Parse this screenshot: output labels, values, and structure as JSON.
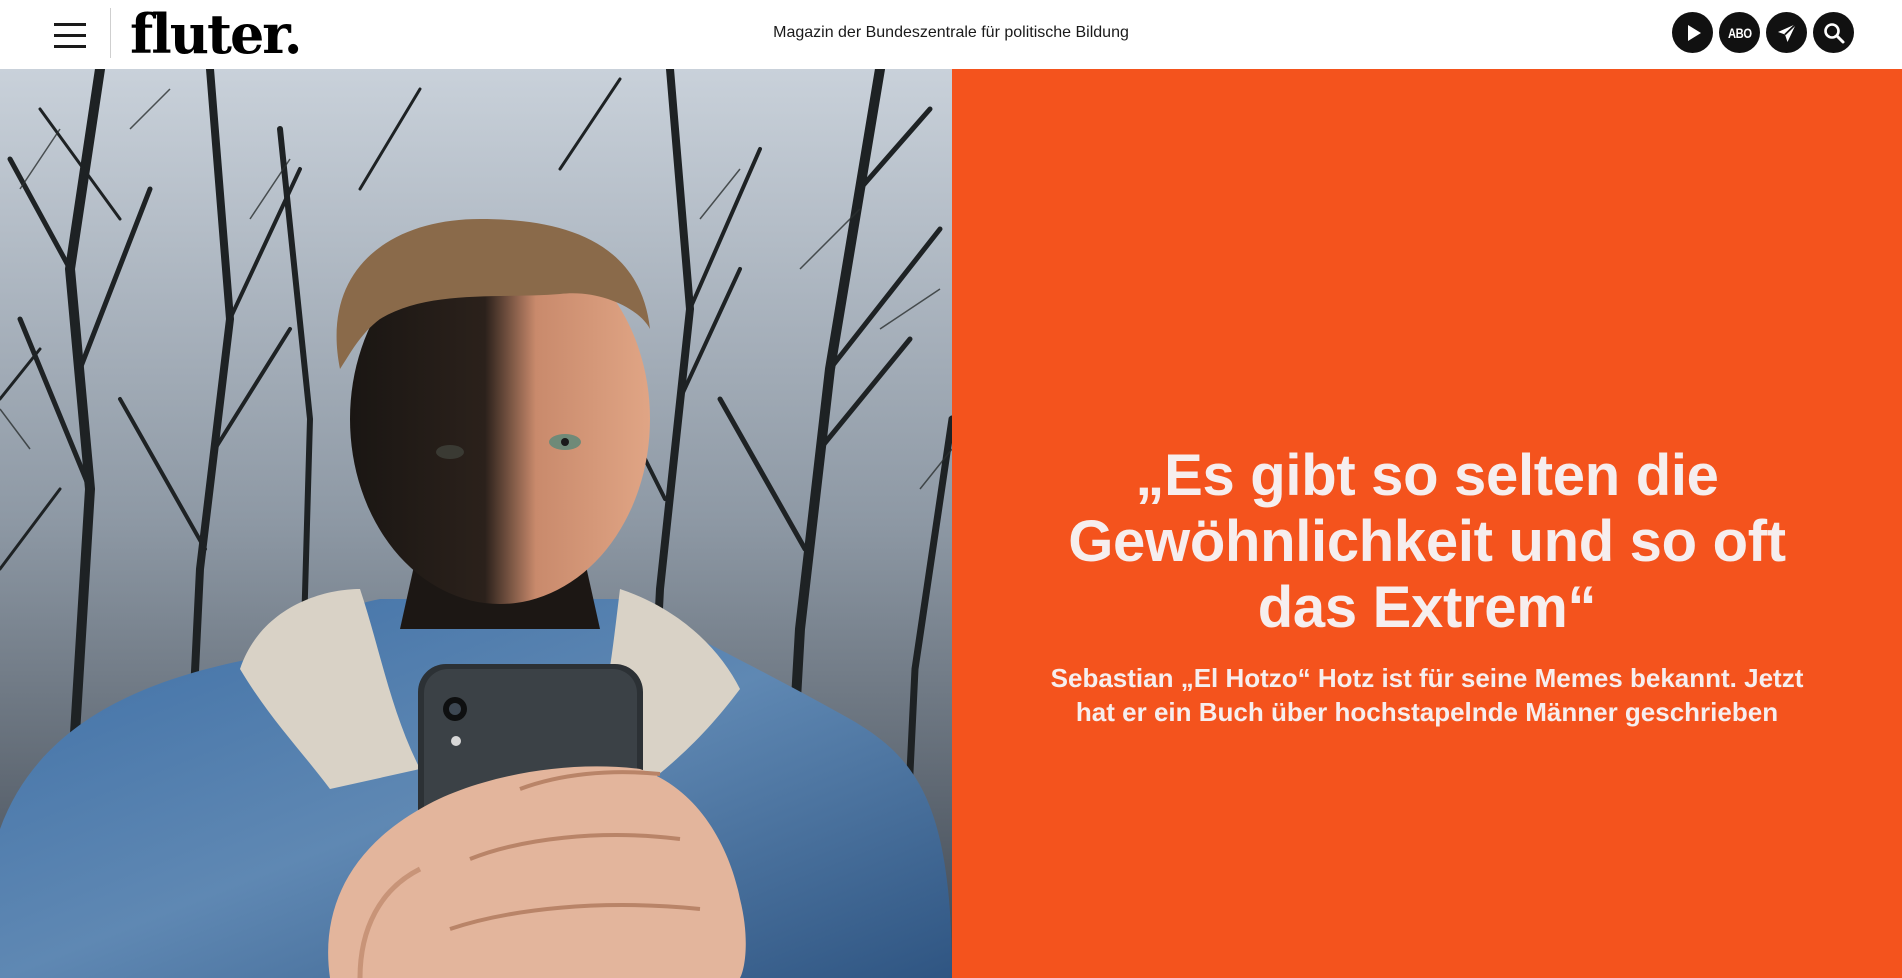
{
  "header": {
    "logo_text": "fluter.",
    "tagline": "Magazin der Bundeszentrale für politische Bildung",
    "menu_icon": "hamburger-menu-icon",
    "actions": {
      "play_icon": "play-icon",
      "abo_label": "ABO",
      "send_icon": "paper-plane-icon",
      "search_icon": "search-icon"
    }
  },
  "hero": {
    "headline": "„Es gibt so selten die Gewöhnlichkeit und so oft das Extrem“",
    "subline": "Sebastian „El Hotzo“ Hotz ist für seine Memes bekannt. Jetzt hat er ein Buch über hochstapelnde Männer geschrieben",
    "panel_color": "#f4531d"
  }
}
